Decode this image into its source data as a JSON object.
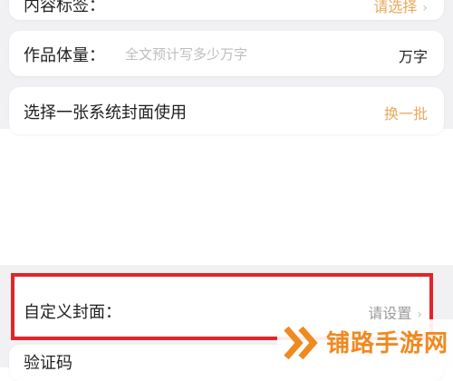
{
  "content_tags": {
    "label": "内容标签：",
    "value": "请选择"
  },
  "work_size": {
    "label": "作品体量：",
    "placeholder": "全文预计写多少万字",
    "unit": "万字"
  },
  "cover_pick": {
    "label": "选择一张系统封面使用",
    "action": "换一批"
  },
  "custom_cover": {
    "label": "自定义封面：",
    "value": "请设置"
  },
  "captcha": {
    "label": "验证码"
  },
  "watermark": {
    "text": "铺路手游网",
    "icon": "double-chevron-logo-icon"
  },
  "icons": {
    "chevron": "chevron-right-icon"
  },
  "colors": {
    "accent": "#e9a85a",
    "highlight_border": "#e0262b",
    "watermark": "#f0891f",
    "background": "#f1f1f3"
  }
}
